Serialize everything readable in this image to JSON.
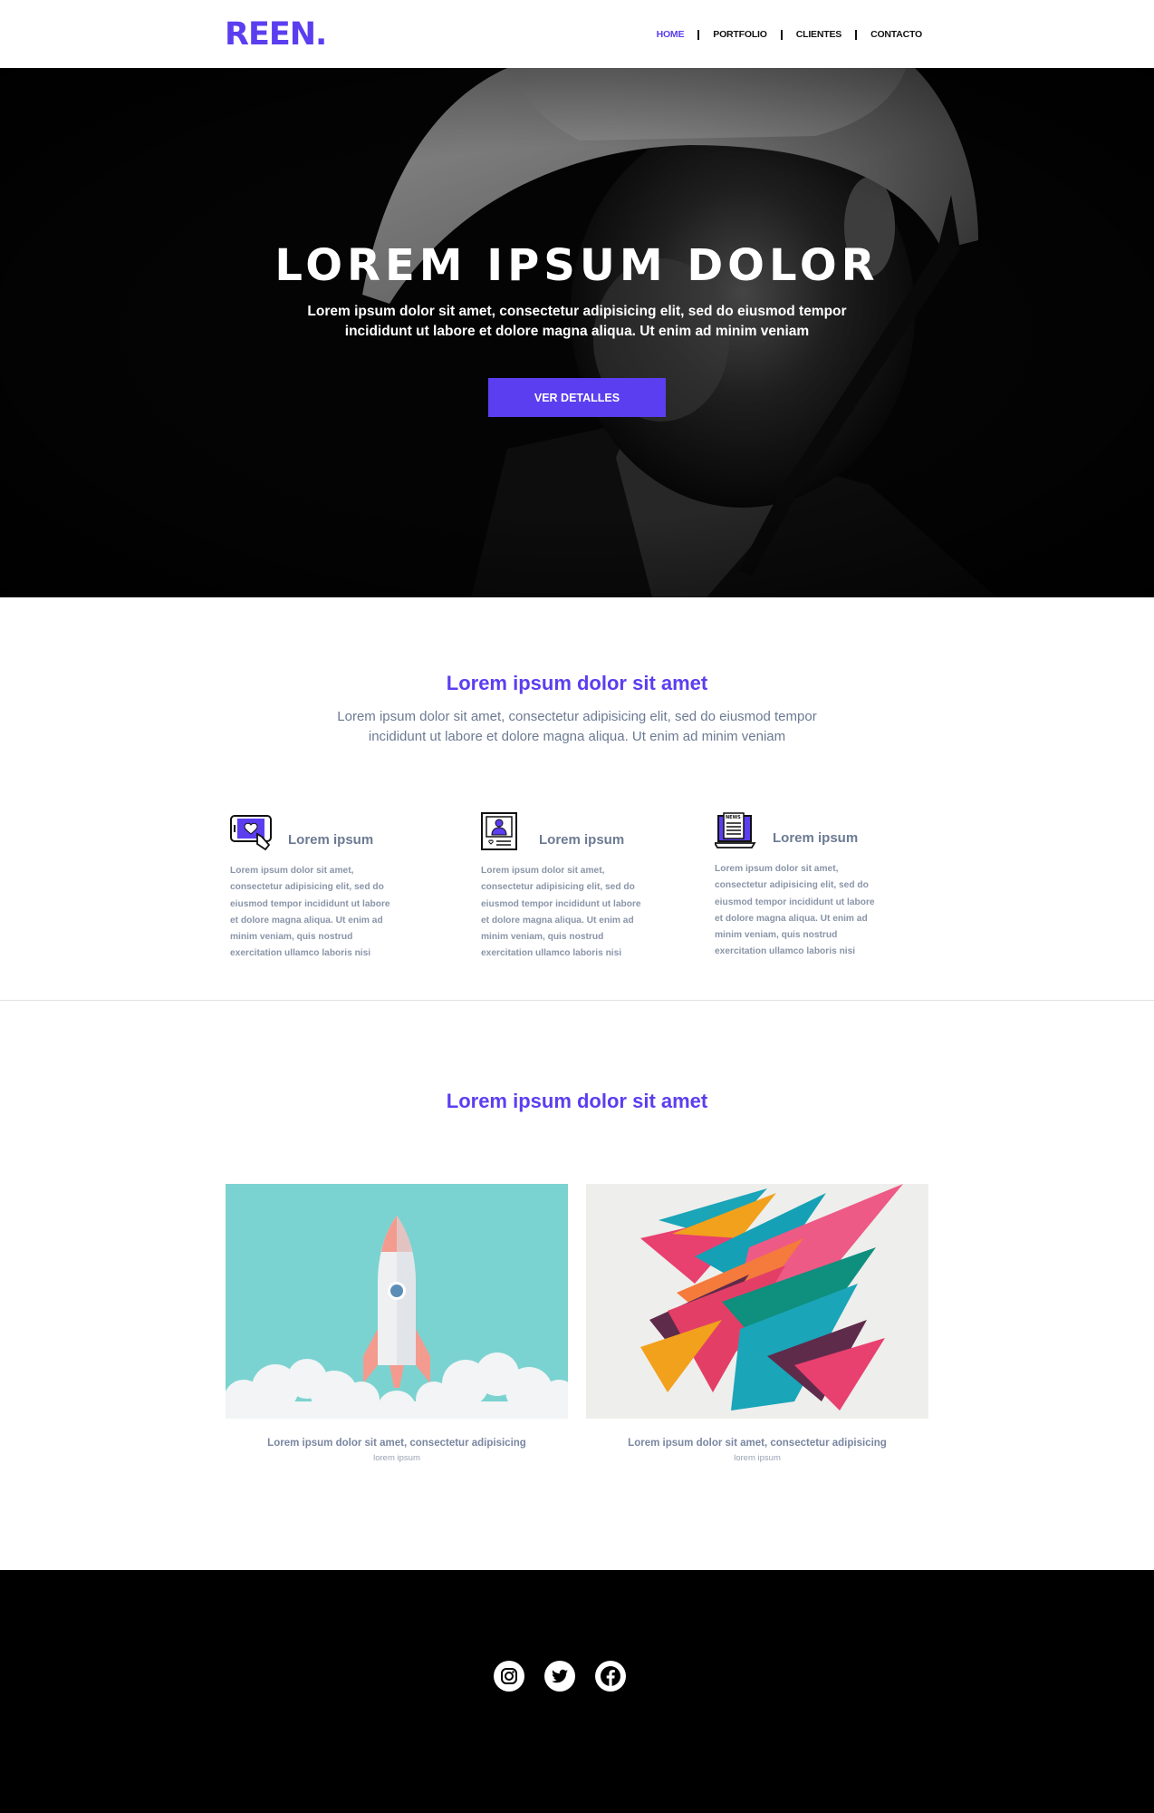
{
  "brand": {
    "logo": "REEN.",
    "accent": "#5b3ef0"
  },
  "nav": {
    "items": [
      {
        "label": "HOME",
        "active": true
      },
      {
        "label": "PORTFOLIO",
        "active": false
      },
      {
        "label": "CLIENTES",
        "active": false
      },
      {
        "label": "CONTACTO",
        "active": false
      }
    ]
  },
  "hero": {
    "title": "LOREM IPSUM DOLOR",
    "subtitle": "Lorem ipsum dolor sit amet, consectetur adipisicing elit, sed do eiusmod tempor incididunt ut labore et dolore magna aliqua. Ut enim ad minim veniam",
    "button": "VER DETALLES",
    "background": "black-and-white photo of a person wearing a hat"
  },
  "services": {
    "title": "Lorem ipsum dolor sit amet",
    "subtitle": "Lorem ipsum dolor sit amet, consectetur adipisicing elit, sed do eiusmod tempor incididunt ut labore et dolore magna aliqua. Ut enim ad minim veniam",
    "items": [
      {
        "icon": "tablet-heart-icon",
        "title": "Lorem ipsum",
        "text": "Lorem ipsum dolor sit amet, consectetur adipisicing elit, sed do eiusmod tempor incididunt ut labore et dolore magna aliqua. Ut enim ad minim veniam, quis nostrud exercitation ullamco laboris nisi"
      },
      {
        "icon": "profile-card-icon",
        "title": "Lorem ipsum",
        "text": "Lorem ipsum dolor sit amet, consectetur adipisicing elit, sed do eiusmod tempor incididunt ut labore et dolore magna aliqua. Ut enim ad minim veniam, quis nostrud exercitation ullamco laboris nisi"
      },
      {
        "icon": "laptop-news-icon",
        "title": "Lorem ipsum",
        "text": "Lorem ipsum dolor sit amet, consectetur adipisicing elit, sed do eiusmod tempor incididunt ut labore et dolore magna aliqua. Ut enim ad minim veniam, quis nostrud exercitation ullamco laboris nisi"
      }
    ]
  },
  "portfolio": {
    "title": "Lorem ipsum dolor sit amet",
    "items": [
      {
        "image": "rocket-illustration",
        "caption": "Lorem ipsum dolor sit amet, consectetur adipisicing",
        "tag": "lorem ipsum"
      },
      {
        "image": "abstract-paper-shapes",
        "caption": "Lorem ipsum dolor sit amet, consectetur adipisicing",
        "tag": "lorem ipsum"
      }
    ]
  },
  "footer": {
    "social": [
      {
        "icon": "instagram-icon"
      },
      {
        "icon": "twitter-icon"
      },
      {
        "icon": "facebook-icon"
      }
    ]
  }
}
